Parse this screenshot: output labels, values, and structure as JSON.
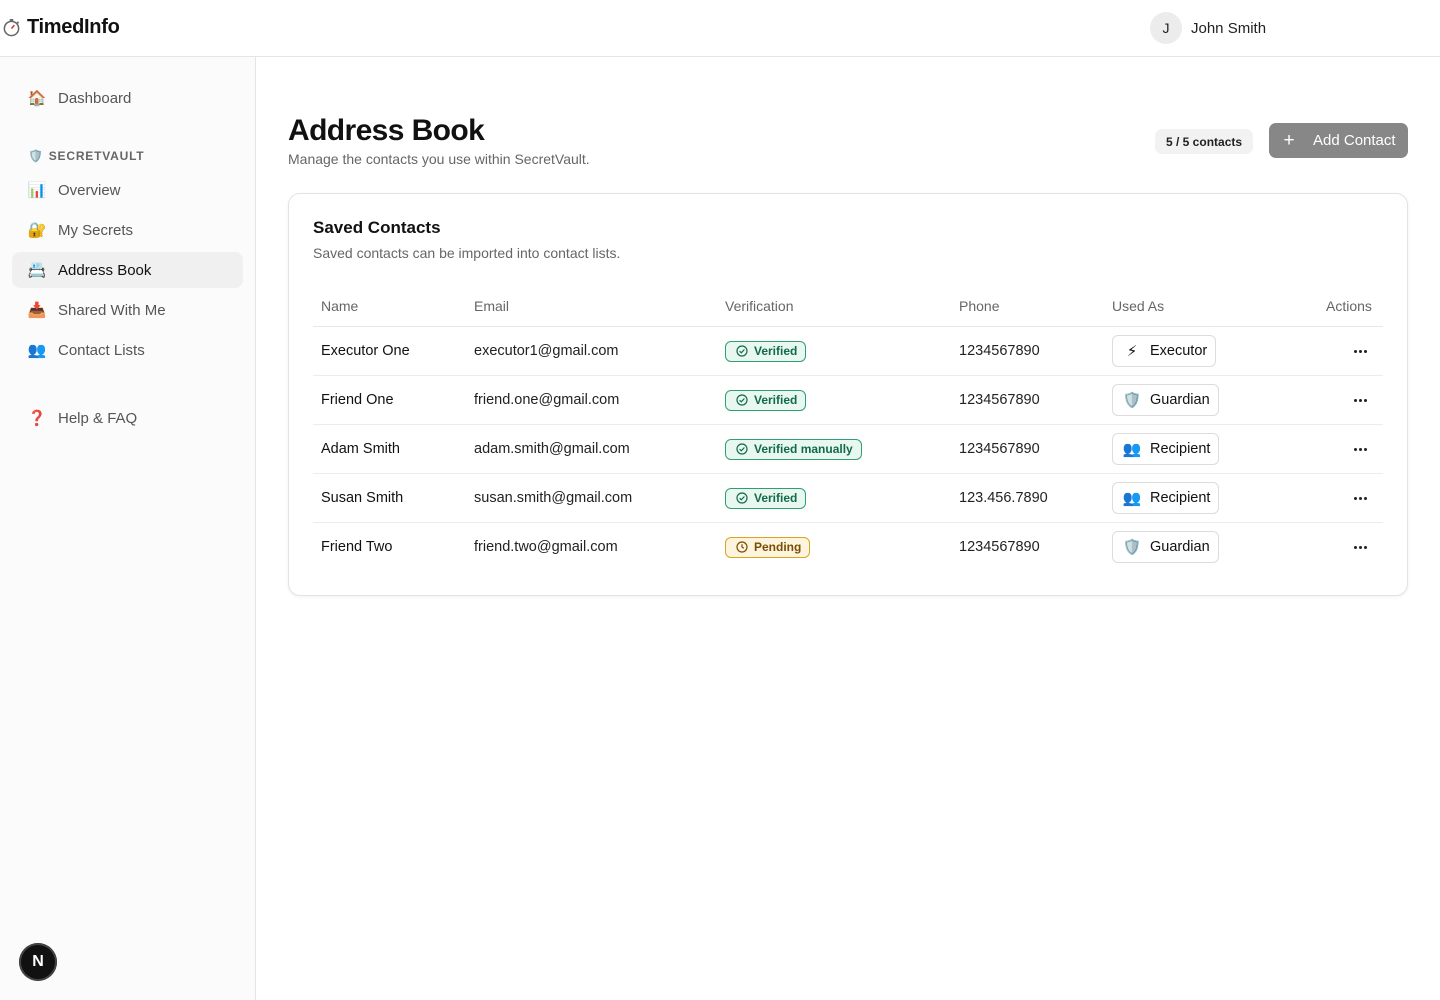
{
  "app": {
    "name": "TimedInfo"
  },
  "user": {
    "initial": "J",
    "name": "John Smith"
  },
  "sidebar": {
    "dashboard": {
      "icon": "🏠",
      "label": "Dashboard"
    },
    "section": {
      "icon": "🛡️",
      "label": "SECRETVAULT"
    },
    "items": [
      {
        "icon": "📊",
        "label": "Overview"
      },
      {
        "icon": "🔐",
        "label": "My Secrets"
      },
      {
        "icon": "📇",
        "label": "Address Book"
      },
      {
        "icon": "📥",
        "label": "Shared With Me"
      },
      {
        "icon": "👥",
        "label": "Contact Lists"
      }
    ],
    "help": {
      "icon": "❓",
      "label": "Help & FAQ"
    },
    "active": "Address Book"
  },
  "page": {
    "title": "Address Book",
    "subtitle": "Manage the contacts you use within SecretVault.",
    "count": "5 / 5 contacts",
    "add_label": "Add Contact",
    "add_icon": "+"
  },
  "card": {
    "title": "Saved Contacts",
    "subtitle": "Saved contacts can be imported into contact lists."
  },
  "table": {
    "headers": [
      "Name",
      "Email",
      "Verification",
      "Phone",
      "Used As",
      "Actions"
    ],
    "rows": [
      {
        "name": "Executor One",
        "email": "executor1@gmail.com",
        "verification": "Verified",
        "status": "verified",
        "phone": "1234567890",
        "used_as": "Executor",
        "used_icon": "⚡"
      },
      {
        "name": "Friend One",
        "email": "friend.one@gmail.com",
        "verification": "Verified",
        "status": "verified",
        "phone": "1234567890",
        "used_as": "Guardian",
        "used_icon": "🛡️"
      },
      {
        "name": "Adam Smith",
        "email": "adam.smith@gmail.com",
        "verification": "Verified manually",
        "status": "verified",
        "phone": "1234567890",
        "used_as": "Recipient",
        "used_icon": "👥"
      },
      {
        "name": "Susan Smith",
        "email": "susan.smith@gmail.com",
        "verification": "Verified",
        "status": "verified",
        "phone": "123.456.7890",
        "used_as": "Recipient",
        "used_icon": "👥"
      },
      {
        "name": "Friend Two",
        "email": "friend.two@gmail.com",
        "verification": "Pending",
        "status": "pending",
        "phone": "1234567890",
        "used_as": "Guardian",
        "used_icon": "🛡️"
      }
    ]
  },
  "dev_badge": "N",
  "colors": {
    "accent_button": "#878787",
    "verified": "#2f9e74",
    "pending": "#d9a520"
  }
}
